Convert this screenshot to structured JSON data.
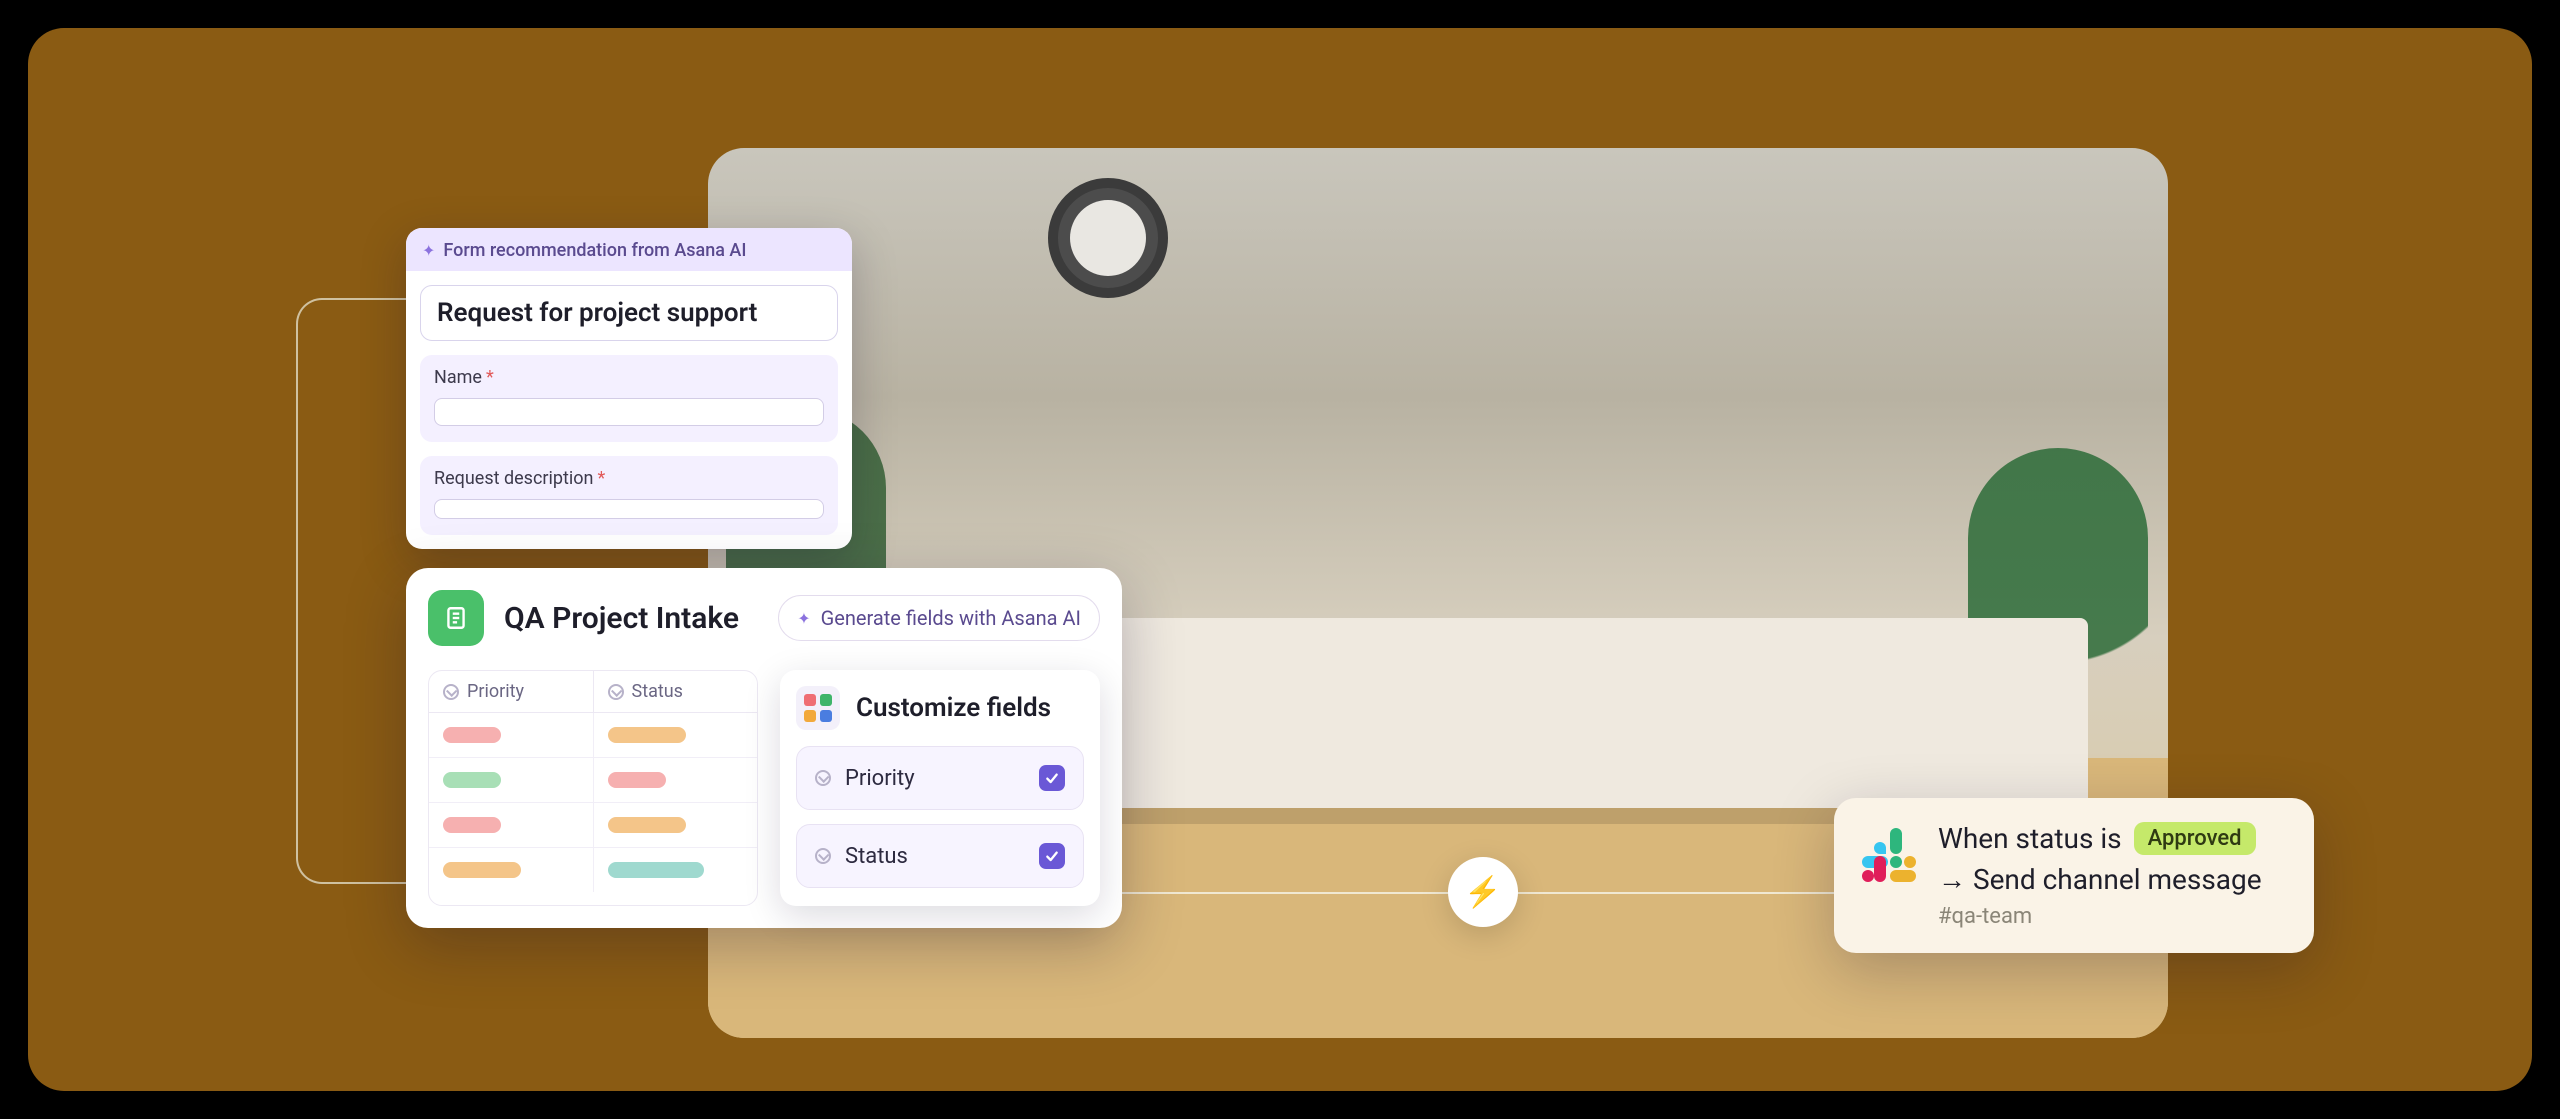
{
  "form_card": {
    "header_label": "Form recommendation from Asana AI",
    "title": "Request for project support",
    "name_label": "Name",
    "desc_label": "Request description"
  },
  "intake": {
    "title": "QA Project Intake",
    "generate_label": "Generate fields with Asana AI",
    "col_priority": "Priority",
    "col_status": "Status"
  },
  "customize": {
    "title": "Customize fields",
    "field_priority": "Priority",
    "field_status": "Status"
  },
  "rule": {
    "prefix": "When status is",
    "status_value": "Approved",
    "arrow": "→",
    "action": "Send channel message",
    "channel": "#qa-team"
  }
}
